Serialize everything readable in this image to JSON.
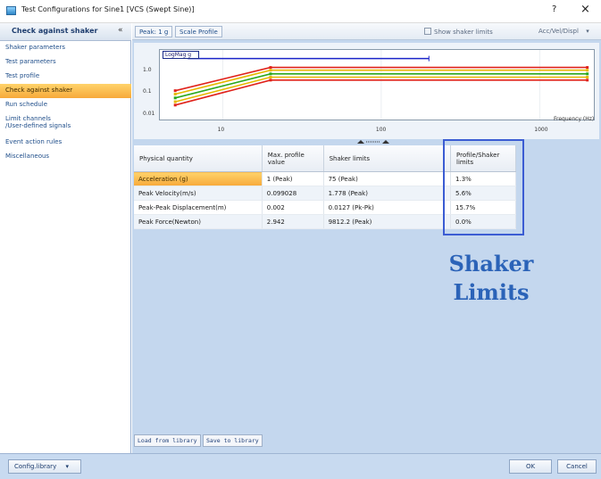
{
  "window": {
    "title": "Test Configurations for Sine1 [VCS (Swept Sine)]",
    "help_glyph": "?",
    "close_glyph": "×",
    "icon": "app-icon"
  },
  "nav": {
    "header": "Check against shaker",
    "pin_glyph": "«",
    "items": [
      {
        "label": "Shaker parameters",
        "selected": false
      },
      {
        "label": "Test parameters",
        "selected": false
      },
      {
        "label": "Test profile",
        "selected": false
      },
      {
        "label": "Check against shaker",
        "selected": true
      },
      {
        "label": "Run schedule",
        "selected": false
      },
      {
        "label": "Limit channels\n/User-defined signals",
        "selected": false
      },
      {
        "label": "Event action rules",
        "selected": false
      },
      {
        "label": "Miscellaneous",
        "selected": false
      }
    ]
  },
  "toolbar": {
    "peak": "Peak: 1 g",
    "scale_profile": "Scale Profile",
    "show_shaker_limits": "Show shaker limits",
    "units_dropdown": "Acc/Vel/Displ"
  },
  "chart_data": {
    "type": "line",
    "legend": "LogMag g",
    "x_axis": {
      "label": "Frequency (Hz)",
      "scale": "log",
      "ticks": [
        "10",
        "100",
        "1000"
      ]
    },
    "y_axis": {
      "scale": "log",
      "ticks": [
        "1.0",
        "0.1",
        "0.01"
      ]
    },
    "series": [
      {
        "color": "#e0231c",
        "points": [
          [
            5,
            0.13
          ],
          [
            20,
            1.55
          ],
          [
            2000,
            1.55
          ]
        ]
      },
      {
        "color": "#e6b800",
        "points": [
          [
            5,
            0.09
          ],
          [
            20,
            1.15
          ],
          [
            2000,
            1.15
          ]
        ]
      },
      {
        "color": "#2aa81e",
        "points": [
          [
            5,
            0.06
          ],
          [
            20,
            0.78
          ],
          [
            2000,
            0.78
          ]
        ]
      },
      {
        "color": "#e6b800",
        "points": [
          [
            5,
            0.04
          ],
          [
            20,
            0.55
          ],
          [
            2000,
            0.55
          ]
        ]
      },
      {
        "color": "#e0231c",
        "points": [
          [
            5,
            0.028
          ],
          [
            20,
            0.4
          ],
          [
            2000,
            0.4
          ]
        ]
      }
    ],
    "reference_line": {
      "color": "#1c25c9",
      "from": [
        6,
        4.0
      ],
      "to": [
        200,
        4.0
      ]
    }
  },
  "table": {
    "columns": [
      "Physical quantity",
      "Max. profile value",
      "Shaker limits",
      "Profile/Shaker limits"
    ],
    "rows": [
      {
        "quantity": "Acceleration (g)",
        "max": "1 (Peak)",
        "limit": "75 (Peak)",
        "ratio": "1.3%"
      },
      {
        "quantity": "Peak Velocity(m/s)",
        "max": "0.099028",
        "limit": "1.778 (Peak)",
        "ratio": "5.6%"
      },
      {
        "quantity": "Peak-Peak Displacement(m)",
        "max": "0.002",
        "limit": "0.0127 (Pk-Pk)",
        "ratio": "15.7%"
      },
      {
        "quantity": "Peak Force(Newton)",
        "max": "2.942",
        "limit": "9812.2 (Peak)",
        "ratio": "0.0%"
      }
    ]
  },
  "annotation": "Shaker\nLimits",
  "annotation_color": "#2b63b8",
  "library": {
    "load": "Load from library",
    "save": "Save to library"
  },
  "footer": {
    "config_library": "Config.library",
    "ok": "OK",
    "cancel": "Cancel"
  }
}
